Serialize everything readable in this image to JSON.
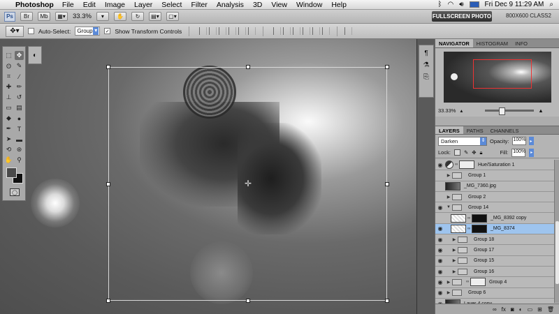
{
  "menubar": {
    "app_name": "Photoshop",
    "menus": [
      "File",
      "Edit",
      "Image",
      "Layer",
      "Select",
      "Filter",
      "Analysis",
      "3D",
      "View",
      "Window",
      "Help"
    ],
    "clock": "Fri Dec 9  11:29 AM",
    "battery_icon": "battery-icon",
    "wifi_icon": "wifi-icon"
  },
  "appbar": {
    "logo": "Ps",
    "btn1": "Br",
    "btn2": "Mb",
    "zoom": "33.3%",
    "workspace_active": "FULLSCREEN PHOTO",
    "workspace_other": "800X600 CLASS2"
  },
  "options": {
    "auto_select_label": "Auto-Select:",
    "auto_select_value": "Group",
    "show_transform_label": "Show Transform Controls",
    "show_transform_checked": "✓"
  },
  "navigator": {
    "tabs": [
      "NAVIGATOR",
      "HISTOGRAM",
      "INFO"
    ],
    "zoom": "33.33%"
  },
  "layers_panel": {
    "tabs": [
      "LAYERS",
      "PATHS",
      "CHANNELS"
    ],
    "blend_mode": "Darken",
    "opacity_label": "Opacity:",
    "opacity_value": "100%",
    "lock_label": "Lock:",
    "fill_label": "Fill:",
    "fill_value": "100%",
    "layers": [
      {
        "name": "Hue/Saturation 1",
        "visible": true,
        "kind": "adjustment"
      },
      {
        "name": "Group 1",
        "visible": false,
        "kind": "group"
      },
      {
        "name": "_MG_7360.jpg",
        "visible": false,
        "kind": "photo"
      },
      {
        "name": "Group 2",
        "visible": false,
        "kind": "group"
      },
      {
        "name": "Group 14",
        "visible": true,
        "kind": "group-open"
      },
      {
        "name": "_MG_8392 copy",
        "visible": false,
        "kind": "masked"
      },
      {
        "name": "_MG_8374",
        "visible": true,
        "kind": "masked",
        "selected": true
      },
      {
        "name": "Group 18",
        "visible": true,
        "kind": "group"
      },
      {
        "name": "Group 17",
        "visible": true,
        "kind": "group"
      },
      {
        "name": "Group 15",
        "visible": true,
        "kind": "group"
      },
      {
        "name": "Group 16",
        "visible": true,
        "kind": "group"
      },
      {
        "name": "Group 4",
        "visible": true,
        "kind": "group-mask"
      },
      {
        "name": "Group 6",
        "visible": true,
        "kind": "group"
      },
      {
        "name": "Layer 4 copy",
        "visible": true,
        "kind": "photo"
      }
    ]
  }
}
